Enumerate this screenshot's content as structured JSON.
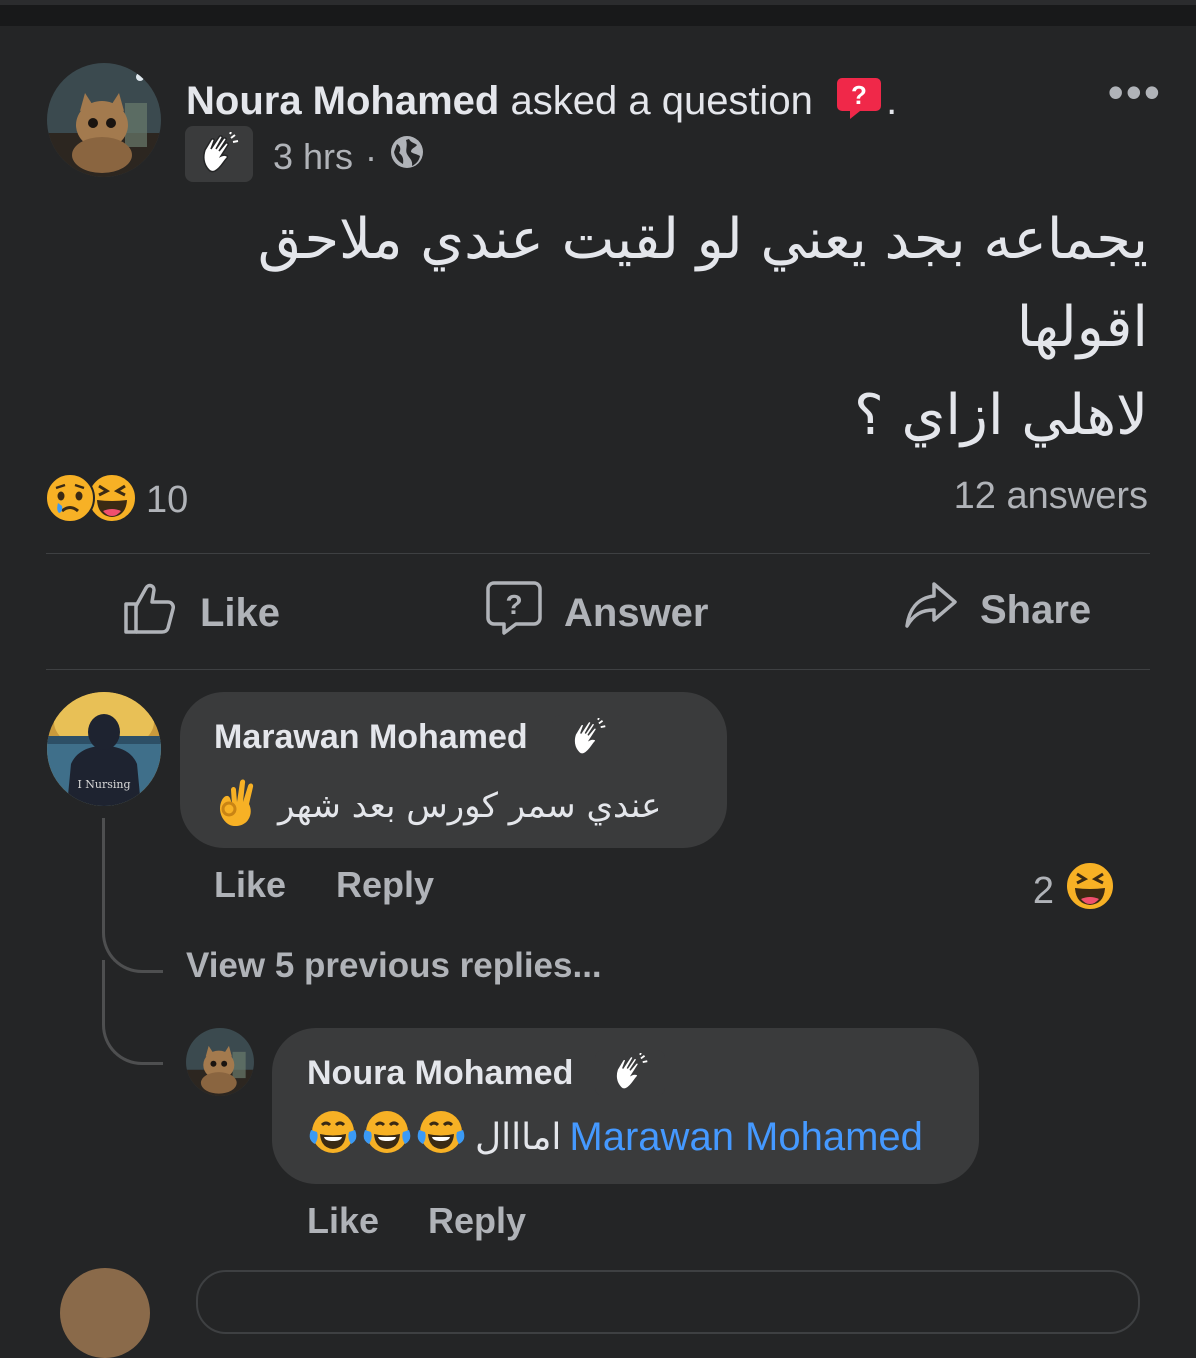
{
  "post": {
    "author": "Noura Mohamed",
    "action_text": "asked a question",
    "time": "3 hrs",
    "separator": "·",
    "text_lines": [
      "يجماعه بجد يعني لو لقيت عندي ملاحق",
      "اقولها",
      "لاهلي ازاي ؟"
    ],
    "reaction_count": "10",
    "answers_count": "12 answers"
  },
  "actions": {
    "like": "Like",
    "answer": "Answer",
    "share": "Share"
  },
  "comment": {
    "author": "Marawan Mohamed",
    "text": "عندي سمر كورس بعد شهر",
    "like": "Like",
    "reply": "Reply",
    "reaction_count": "2"
  },
  "view_previous": "View 5 previous replies...",
  "reply": {
    "author": "Noura Mohamed",
    "text": "امااال",
    "mention": "Marawan Mohamed",
    "like": "Like",
    "reply": "Reply"
  },
  "avatar_caption": "I Nursing",
  "icons": {
    "question_badge": "question-mark-icon",
    "globe": "globe-icon",
    "wave": "waving-hand-icon",
    "more": "more-dots-icon"
  },
  "colors": {
    "background": "#242526",
    "accent": "#4599ff",
    "question_badge": "#f02849"
  }
}
